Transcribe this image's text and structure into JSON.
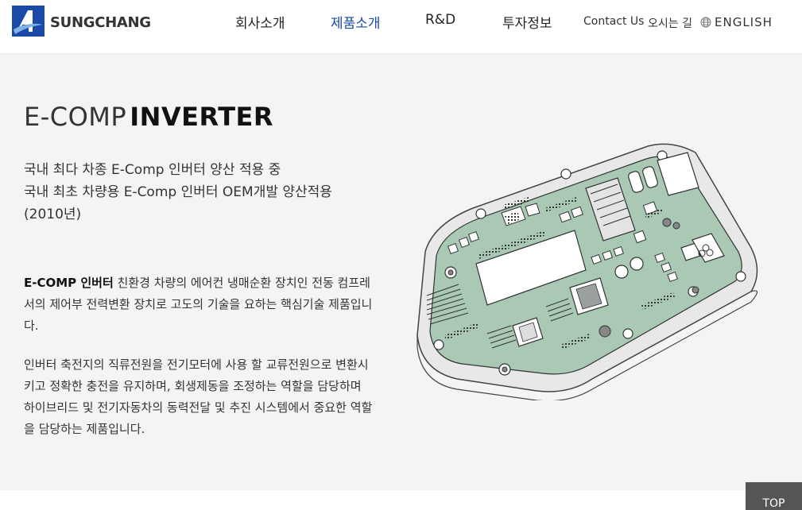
{
  "header": {
    "logo_text": "SUNGCHANG",
    "nav": [
      "회사소개",
      "제품소개",
      "R&D",
      "투자정보"
    ],
    "active_nav": "제품소개",
    "contact": "Contact Us",
    "directions": "오시는 길",
    "language": "ENGLISH"
  },
  "content": {
    "title_thin": "E-COMP",
    "title_bold": "INVERTER",
    "subtitle_line1": "국내 최다 차종 E-Comp 인버터 양산 적용 중",
    "subtitle_line2": "국내 최초 차량용 E-Comp 인버터 OEM개발 양산적용",
    "subtitle_line3": "(2010년)",
    "para1_bold": "E-COMP 인버터",
    "para1_rest": " 친환경 차량의 에어컨 냉매순환 장치인 전동 컴프레서의 제어부 전력변환 장치로 고도의 기술을 요하는 핵심기술 제품입니다.",
    "para2": "인버터 축전지의 직류전원을 전기모터에 사용 할 교류전원으로 변환시키고 정확한 충전을 유지하며, 회생제동을 조정하는 역할을 담당하며 하이브리드 및 전기자동차의 동력전달 및 추진 시스템에서 중요한 역할을 담당하는 제품입니다."
  },
  "top_button": "TOP",
  "colors": {
    "brand_blue": "#1a49a8",
    "pcb_green": "#a9c9b4",
    "background": "#f4f4f4"
  }
}
